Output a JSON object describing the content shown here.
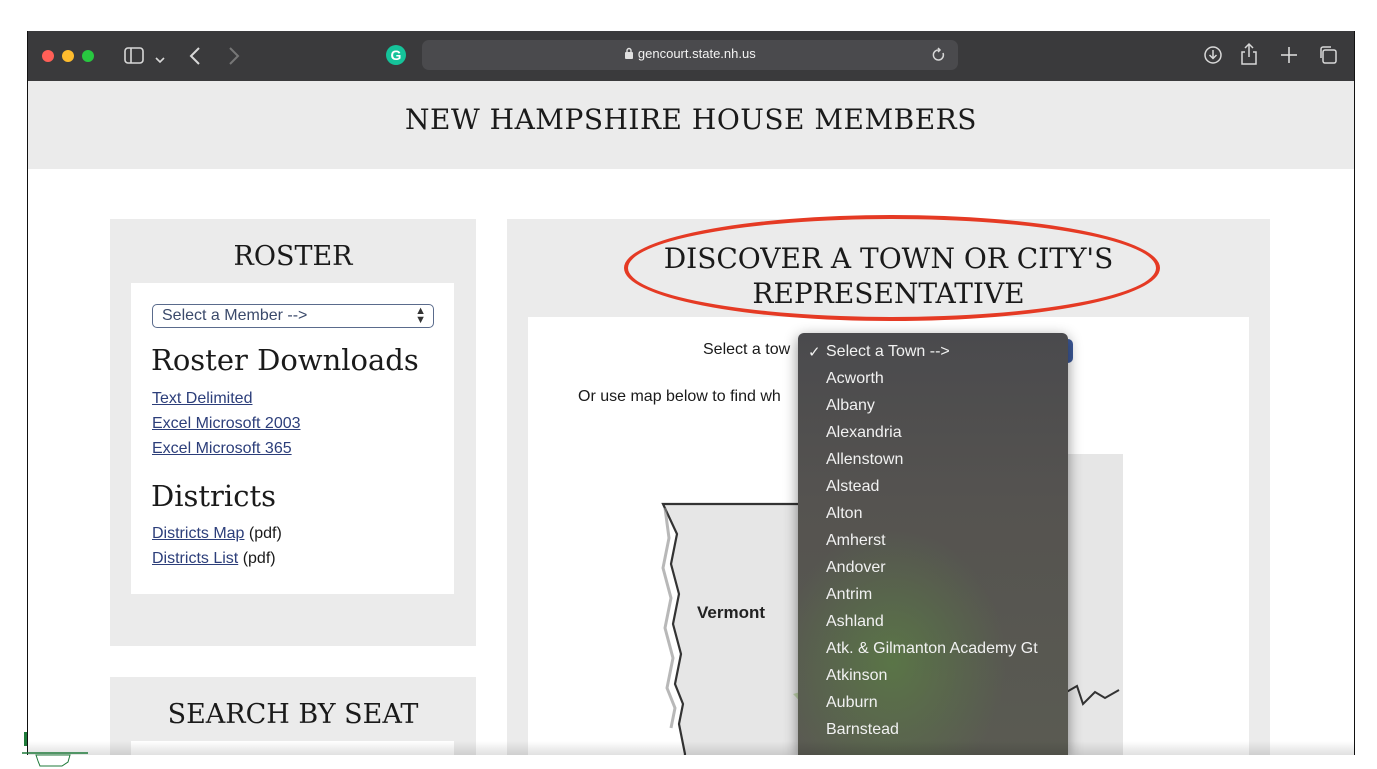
{
  "browser": {
    "url": "gencourt.state.nh.us",
    "colors": {
      "close": "#ff5f57",
      "minimize": "#febc2e",
      "maximize": "#28c840",
      "grammarly": "#15c39a"
    },
    "icons": [
      "sidebar-icon",
      "chevron-down-icon",
      "back-icon",
      "forward-icon",
      "grammarly-icon",
      "lock-icon",
      "reload-icon",
      "download-icon",
      "share-icon",
      "new-tab-icon",
      "tabs-overview-icon"
    ]
  },
  "header": {
    "title": "NEW HAMPSHIRE HOUSE MEMBERS"
  },
  "roster": {
    "heading": "ROSTER",
    "member_select": "Select a Member -->",
    "downloads_heading": "Roster Downloads",
    "downloads": [
      "Text Delimited",
      "Excel Microsoft 2003",
      "Excel Microsoft 365"
    ],
    "districts_heading": "Districts",
    "districts_map": "Districts Map",
    "districts_map_suffix": "(pdf)",
    "districts_list": "Districts List",
    "districts_list_suffix": "(pdf)"
  },
  "search_by_seat": {
    "heading": "SEARCH BY SEAT"
  },
  "discover": {
    "heading_line1": "DISCOVER A TOWN OR CITY'S",
    "heading_line2": "REPRESENTATIVE",
    "select_prompt": "Select a tow",
    "map_prompt": "Or use map below to find wh",
    "map_label": "Vermont",
    "highlight_color": "#e53a24"
  },
  "town_dropdown": {
    "selected": "Select a Town -->",
    "options": [
      "Acworth",
      "Albany",
      "Alexandria",
      "Allenstown",
      "Alstead",
      "Alton",
      "Amherst",
      "Andover",
      "Antrim",
      "Ashland",
      "Atk. & Gilmanton Academy Gt",
      "Atkinson",
      "Auburn",
      "Barnstead"
    ]
  }
}
